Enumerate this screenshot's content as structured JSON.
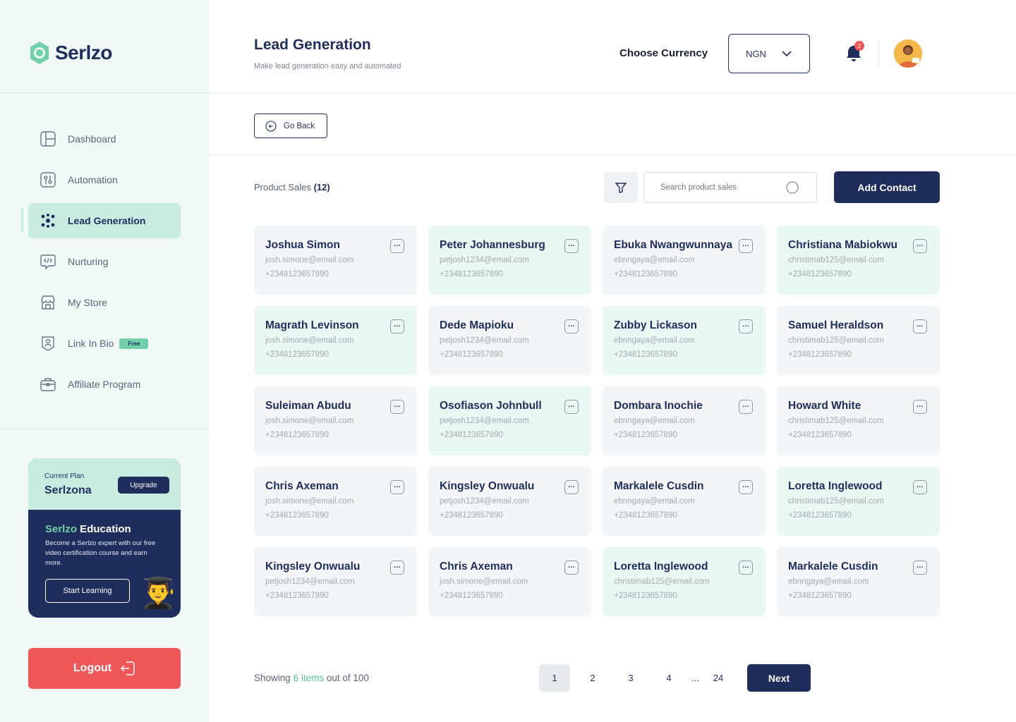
{
  "brand": {
    "name": "Serlzo"
  },
  "sidebar": {
    "items": [
      {
        "label": "Dashboard",
        "icon": "dashboard-icon",
        "active": false
      },
      {
        "label": "Automation",
        "icon": "automation-icon",
        "active": false
      },
      {
        "label": "Lead Generation",
        "icon": "lead-generation-icon",
        "active": true
      },
      {
        "label": "Nurturing",
        "icon": "chat-code-icon",
        "active": false
      },
      {
        "label": "My Store",
        "icon": "store-icon",
        "active": false
      },
      {
        "label": "Link In Bio",
        "icon": "link-in-bio-icon",
        "active": false,
        "badge": "Free"
      },
      {
        "label": "Affiliate Program",
        "icon": "briefcase-icon",
        "active": false
      }
    ],
    "plan": {
      "label": "Current Plan",
      "name": "Serlzona",
      "upgrade_label": "Upgrade"
    },
    "education": {
      "title_highlight": "Serlzo",
      "title_rest": " Education",
      "text": "Become a Serlzo expert with our free video certification course and earn more.",
      "button_label": "Start Learning",
      "emoji": "👨‍🎓"
    },
    "logout_label": "Logout"
  },
  "header": {
    "title": "Lead Generation",
    "subtitle": "Make lead generation easy and automated",
    "currency_label": "Choose Currency",
    "currency_value": "NGN",
    "notification_count": "2"
  },
  "toolbar": {
    "go_back_label": "Go Back",
    "section_label": "Product Sales",
    "section_count": "(12)",
    "search_placeholder": "Search product sales",
    "add_contact_label": "Add Contact"
  },
  "contacts": [
    {
      "name": "Joshua Simon",
      "email": "josh.simone@email.com",
      "phone": "+2348123657890",
      "highlight": false
    },
    {
      "name": "Peter Johannesburg",
      "email": "petjosh1234@email.com",
      "phone": "+2348123657890",
      "highlight": true
    },
    {
      "name": "Ebuka Nwangwunnaya",
      "email": "ebnngaya@email.com",
      "phone": "+2348123657890",
      "highlight": false
    },
    {
      "name": "Christiana Mabiokwu",
      "email": "christimab125@email.com",
      "phone": "+2348123657890",
      "highlight": true
    },
    {
      "name": "Magrath Levinson",
      "email": "josh.simone@email.com",
      "phone": "+2348123657890",
      "highlight": true
    },
    {
      "name": "Dede Mapioku",
      "email": "petjosh1234@email.com",
      "phone": "+2348123657890",
      "highlight": false
    },
    {
      "name": "Zubby Lickason",
      "email": "ebnngaya@email.com",
      "phone": "+2348123657890",
      "highlight": true
    },
    {
      "name": "Samuel Heraldson",
      "email": "christimab125@email.com",
      "phone": "+2348123657890",
      "highlight": false
    },
    {
      "name": "Suleiman Abudu",
      "email": "josh.simone@email.com",
      "phone": "+2348123657890",
      "highlight": false
    },
    {
      "name": "Osofiason Johnbull",
      "email": "petjosh1234@email.com",
      "phone": "+2348123657890",
      "highlight": true
    },
    {
      "name": "Dombara Inochie",
      "email": "ebnngaya@email.com",
      "phone": "+2348123657890",
      "highlight": false
    },
    {
      "name": "Howard White",
      "email": "christimab125@email.com",
      "phone": "+2348123657890",
      "highlight": false
    },
    {
      "name": "Chris Axeman",
      "email": "josh.simone@email.com",
      "phone": "+2348123657890",
      "highlight": false
    },
    {
      "name": "Kingsley Onwualu",
      "email": "petjosh1234@email.com",
      "phone": "+2348123657890",
      "highlight": false
    },
    {
      "name": "Markalele Cusdin",
      "email": "ebnngaya@email.com",
      "phone": "+2348123657890",
      "highlight": false
    },
    {
      "name": "Loretta Inglewood",
      "email": "christimab125@email.com",
      "phone": "+2348123657890",
      "highlight": true
    },
    {
      "name": "Kingsley Onwualu",
      "email": "petjosh1234@email.com",
      "phone": "+2348123657890",
      "highlight": false
    },
    {
      "name": "Chris Axeman",
      "email": "josh.simone@email.com",
      "phone": "+2348123657890",
      "highlight": false
    },
    {
      "name": "Loretta Inglewood",
      "email": "christimab125@email.com",
      "phone": "+2348123657890",
      "highlight": true
    },
    {
      "name": "Markalele Cusdin",
      "email": "ebnngaya@email.com",
      "phone": "+2348123657890",
      "highlight": false
    }
  ],
  "pagination": {
    "showing_prefix": "Showing",
    "showing_items": "6 items",
    "showing_suffix": "out of 100",
    "pages": [
      "1",
      "2",
      "3",
      "4"
    ],
    "ellipsis": "...",
    "last_page": "24",
    "current_page": "1",
    "next_label": "Next"
  },
  "colors": {
    "primary": "#1f2d5c",
    "accent_green": "#6fd0aa",
    "card_green": "#e9f8f2",
    "logout_red": "#ee5658"
  }
}
